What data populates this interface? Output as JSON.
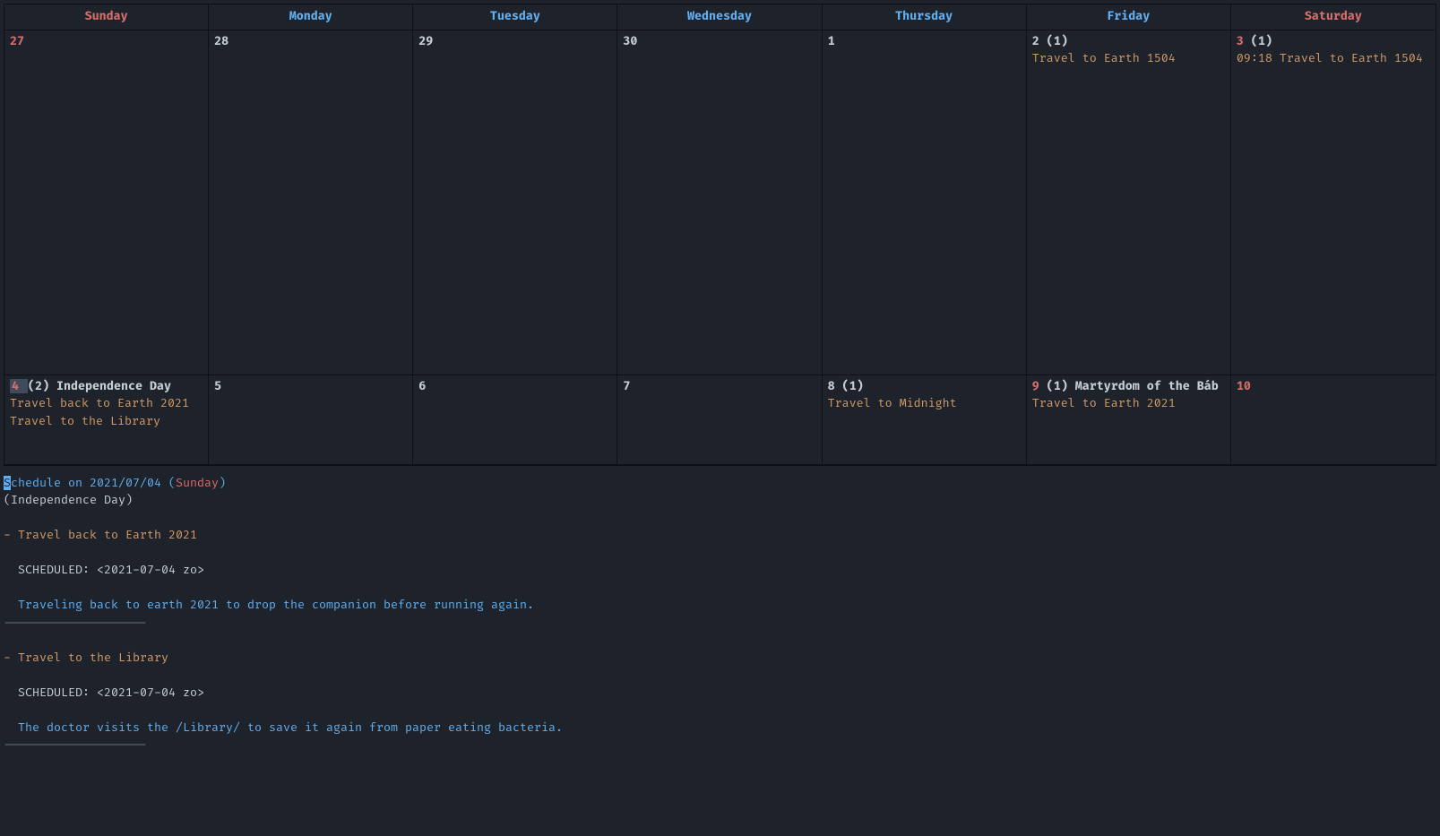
{
  "headers": [
    "Sunday",
    "Monday",
    "Tuesday",
    "Wednesday",
    "Thursday",
    "Friday",
    "Saturday"
  ],
  "weekend_indices": [
    0,
    6
  ],
  "rows": [
    [
      {
        "day": "27",
        "weekend": true,
        "dim": false
      },
      {
        "day": "28"
      },
      {
        "day": "29"
      },
      {
        "day": "30"
      },
      {
        "day": "1"
      },
      {
        "day": "2",
        "count": "(1)",
        "events": [
          "Travel to Earth 1504"
        ]
      },
      {
        "day": "3",
        "weekend": true,
        "count": "(1)",
        "events": [
          "09:18 Travel to Earth 1504"
        ]
      }
    ],
    [
      {
        "day": "4",
        "weekend": true,
        "selected": true,
        "count": "(2)",
        "holiday": "Independence Day",
        "events": [
          "Travel back to Earth 2021",
          "Travel to the Library"
        ]
      },
      {
        "day": "5"
      },
      {
        "day": "6"
      },
      {
        "day": "7"
      },
      {
        "day": "8",
        "count": "(1)",
        "events": [
          "Travel to Midnight"
        ]
      },
      {
        "day": "9",
        "weekend": true,
        "count": "(1)",
        "holiday": "Martyrdom of the Báb",
        "events": [
          "Travel to Earth 2021"
        ]
      },
      {
        "day": "10",
        "weekend": true
      }
    ]
  ],
  "schedule": {
    "title_prefix": "chedule on 2021/07/04 (",
    "title_first_char": "S",
    "title_day": "Sunday",
    "title_suffix": ")",
    "subtitle": "(Independence Day)",
    "items": [
      {
        "bullet": "- Travel back to Earth 2021",
        "scheduled": "SCHEDULED: <2021-07-04 zo>",
        "body": "Traveling back to earth 2021 to drop the companion before running again."
      },
      {
        "bullet": "- Travel to the Library",
        "scheduled": "SCHEDULED: <2021-07-04 zo>",
        "body": "The doctor visits the /Library/ to save it again from paper eating bacteria."
      }
    ],
    "divider": "--------------------"
  }
}
